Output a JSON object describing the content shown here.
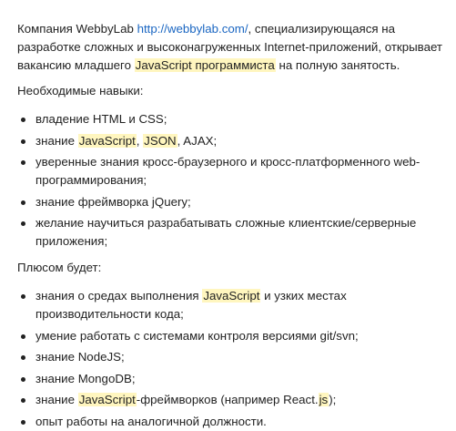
{
  "colors": {
    "text": "#222222",
    "link": "#1a66c2",
    "highlight": "#fff6bf"
  },
  "intro": {
    "company_prefix": "Компания WebbyLab ",
    "company_link": "http://webbylab.com/",
    "text_after_link": ", специализирующаяся на разработке сложных и высоконагруженных Internet-приложений, открывает вакансию младшего ",
    "highlight": "JavaScript программиста",
    "text_end": " на полную занятость."
  },
  "skills": {
    "heading": "Необходимые навыки:",
    "items": [
      {
        "text": "владение HTML и CSS;"
      },
      {
        "prefix": "знание ",
        "highlight1": "JavaScript",
        "mid": ", ",
        "highlight2": "JSON",
        "suffix": ", AJAX;"
      },
      {
        "text": "уверенные знания кросс-браузерного и кросс-платформенного web-программирования;"
      },
      {
        "text": "знание фреймворка jQuery;"
      },
      {
        "text": "желание научиться разрабатывать сложные клиентские/серверные приложения;"
      }
    ]
  },
  "pluses": {
    "heading": "Плюсом будет:",
    "items": [
      {
        "prefix": "знания о средах выполнения ",
        "highlight": "JavaScript",
        "suffix": " и узких местах производительности кода;"
      },
      {
        "text": "умение работать с системами контроля версиями git/svn;"
      },
      {
        "text": "знание NodeJS;"
      },
      {
        "text": "знание MongoDB;"
      },
      {
        "prefix": "знание ",
        "highlight1": "JavaScript",
        "mid": "-фреймворков (например React.",
        "highlight2": "js",
        "suffix": ");"
      },
      {
        "text": "опыт работы на аналогичной должности."
      }
    ]
  }
}
